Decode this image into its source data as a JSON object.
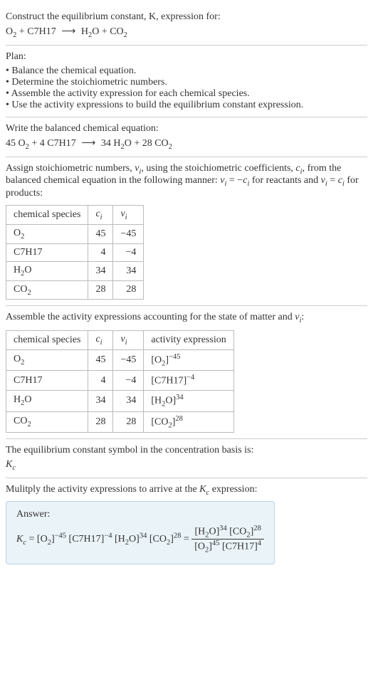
{
  "prompt": {
    "line1": "Construct the equilibrium constant, K, expression for:",
    "eq_lhs_a": "O",
    "eq_lhs_a_sub": "2",
    "plus1": " + ",
    "eq_lhs_b": "C7H17",
    "arrow": "⟶",
    "eq_rhs_a": "H",
    "eq_rhs_a_sub": "2",
    "eq_rhs_a2": "O",
    "plus2": " + ",
    "eq_rhs_b": "CO",
    "eq_rhs_b_sub": "2"
  },
  "plan": {
    "title": "Plan:",
    "b1": "Balance the chemical equation.",
    "b2": "Determine the stoichiometric numbers.",
    "b3": "Assemble the activity expression for each chemical species.",
    "b4": "Use the activity expressions to build the equilibrium constant expression."
  },
  "balanced": {
    "title": "Write the balanced chemical equation:",
    "c1": "45 ",
    "s1a": "O",
    "s1b": "2",
    "plus1": " + ",
    "c2": "4 ",
    "s2": "C7H17",
    "arrow": "⟶",
    "c3": "34 ",
    "s3a": "H",
    "s3b": "2",
    "s3c": "O",
    "plus2": " + ",
    "c4": "28 ",
    "s4a": "CO",
    "s4b": "2"
  },
  "stoich": {
    "intro1": "Assign stoichiometric numbers, ",
    "nu": "ν",
    "nu_sub": "i",
    "intro2": ", using the stoichiometric coefficients, ",
    "c": "c",
    "c_sub": "i",
    "intro3": ", from the balanced chemical equation in the following manner: ",
    "rel1a": "ν",
    "rel1b": "i",
    "rel1c": " = −",
    "rel1d": "c",
    "rel1e": "i",
    "intro4": " for reactants and ",
    "rel2a": "ν",
    "rel2b": "i",
    "rel2c": " = ",
    "rel2d": "c",
    "rel2e": "i",
    "intro5": " for products:",
    "h1": "chemical species",
    "h2": "c",
    "h2s": "i",
    "h3": "ν",
    "h3s": "i",
    "rows": [
      {
        "sp_a": "O",
        "sp_b": "2",
        "sp_c": "",
        "c": "45",
        "nu": "−45"
      },
      {
        "sp_a": "C7H17",
        "sp_b": "",
        "sp_c": "",
        "c": "4",
        "nu": "−4"
      },
      {
        "sp_a": "H",
        "sp_b": "2",
        "sp_c": "O",
        "c": "34",
        "nu": "34"
      },
      {
        "sp_a": "CO",
        "sp_b": "2",
        "sp_c": "",
        "c": "28",
        "nu": "28"
      }
    ]
  },
  "activity": {
    "intro1": "Assemble the activity expressions accounting for the state of matter and ",
    "nu": "ν",
    "nu_sub": "i",
    "intro2": ":",
    "h1": "chemical species",
    "h2": "c",
    "h2s": "i",
    "h3": "ν",
    "h3s": "i",
    "h4": "activity expression",
    "rows": [
      {
        "sp_a": "O",
        "sp_b": "2",
        "sp_c": "",
        "c": "45",
        "nu": "−45",
        "ae_a": "[O",
        "ae_b": "2",
        "ae_c": "]",
        "ae_exp": "−45"
      },
      {
        "sp_a": "C7H17",
        "sp_b": "",
        "sp_c": "",
        "c": "4",
        "nu": "−4",
        "ae_a": "[C7H17]",
        "ae_b": "",
        "ae_c": "",
        "ae_exp": "−4"
      },
      {
        "sp_a": "H",
        "sp_b": "2",
        "sp_c": "O",
        "c": "34",
        "nu": "34",
        "ae_a": "[H",
        "ae_b": "2",
        "ae_c": "O]",
        "ae_exp": "34"
      },
      {
        "sp_a": "CO",
        "sp_b": "2",
        "sp_c": "",
        "c": "28",
        "nu": "28",
        "ae_a": "[CO",
        "ae_b": "2",
        "ae_c": "]",
        "ae_exp": "28"
      }
    ]
  },
  "symbol": {
    "line1": "The equilibrium constant symbol in the concentration basis is:",
    "k": "K",
    "ksub": "c"
  },
  "final": {
    "intro1": "Mulitply the activity expressions to arrive at the ",
    "k": "K",
    "ksub": "c",
    "intro2": " expression:",
    "answer_label": "Answer:",
    "lhs_k": "K",
    "lhs_ks": "c",
    "eq": " = ",
    "t1a": "[O",
    "t1b": "2",
    "t1c": "]",
    "t1e": "−45",
    "sp1": " ",
    "t2a": "[C7H17]",
    "t2e": "−4",
    "sp2": " ",
    "t3a": "[H",
    "t3b": "2",
    "t3c": "O]",
    "t3e": "34",
    "sp3": " ",
    "t4a": "[CO",
    "t4b": "2",
    "t4c": "]",
    "t4e": "28",
    "eq2": " = ",
    "num1a": "[H",
    "num1b": "2",
    "num1c": "O]",
    "num1e": "34",
    "numsp": " ",
    "num2a": "[CO",
    "num2b": "2",
    "num2c": "]",
    "num2e": "28",
    "den1a": "[O",
    "den1b": "2",
    "den1c": "]",
    "den1e": "45",
    "densp": " ",
    "den2a": "[C7H17]",
    "den2e": "4"
  }
}
